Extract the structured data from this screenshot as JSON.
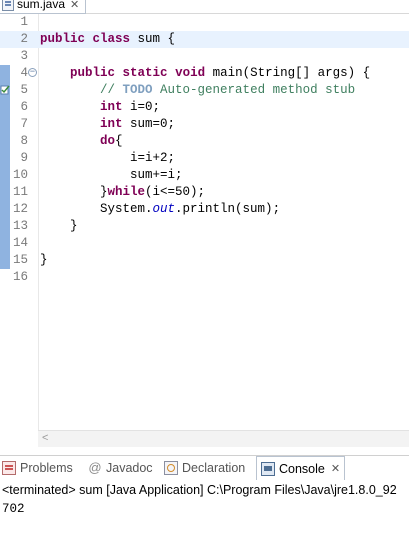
{
  "editor": {
    "tab": {
      "title": "sum.java",
      "icon": "java-file-icon",
      "close_icon": "close-icon"
    },
    "current_line": 2,
    "lines": [
      {
        "num": "1",
        "text": ""
      },
      {
        "num": "2",
        "text": "public class sum {"
      },
      {
        "num": "3",
        "text": ""
      },
      {
        "num": "4",
        "text": "    public static void main(String[] args) {"
      },
      {
        "num": "5",
        "text": "        // TODO Auto-generated method stub"
      },
      {
        "num": "6",
        "text": "        int i=0;"
      },
      {
        "num": "7",
        "text": "        int sum=0;"
      },
      {
        "num": "8",
        "text": "        do{"
      },
      {
        "num": "9",
        "text": "            i=i+2;"
      },
      {
        "num": "10",
        "text": "            sum+=i;"
      },
      {
        "num": "11",
        "text": "        }while(i<=50);"
      },
      {
        "num": "12",
        "text": "        System.out.println(sum);"
      },
      {
        "num": "13",
        "text": "    }"
      },
      {
        "num": "14",
        "text": ""
      },
      {
        "num": "15",
        "text": "}"
      },
      {
        "num": "16",
        "text": ""
      }
    ],
    "code_parts": {
      "l2_kw1": "public",
      "l2_kw2": "class",
      "l2_rest": " sum {",
      "l4_kw1": "public",
      "l4_kw2": "static",
      "l4_kw3": "void",
      "l4_rest": " main(String[] args) {",
      "l5_cm1": "// ",
      "l5_todo": "TODO",
      "l5_cm2": " Auto-generated method stub",
      "l6_kw": "int",
      "l6_rest": " i=0;",
      "l7_kw": "int",
      "l7_rest": " sum=0;",
      "l8_kw": "do",
      "l8_rest": "{",
      "l9": "i=i+2;",
      "l10": "sum+=i;",
      "l11_a": "}",
      "l11_kw": "while",
      "l11_b": "(i<=50);",
      "l12_a": "System.",
      "l12_fld": "out",
      "l12_b": ".println(sum);",
      "l13": "}",
      "l15": "}"
    },
    "colors": {
      "keyword": "#7f0055",
      "comment": "#3f7f5f",
      "todo": "#7f9fbf",
      "field": "#0000c0",
      "current_line_bg": "#e8f2fe"
    }
  },
  "views": {
    "tabs": [
      {
        "label": "Problems",
        "icon": "problems-icon"
      },
      {
        "label": "Javadoc",
        "icon": "at-sign-icon"
      },
      {
        "label": "Declaration",
        "icon": "declaration-icon"
      },
      {
        "label": "Console",
        "icon": "console-icon",
        "active": true
      }
    ],
    "console": {
      "status": "<terminated> sum [Java Application] C:\\Program Files\\Java\\jre1.8.0_92",
      "output": "702"
    }
  }
}
